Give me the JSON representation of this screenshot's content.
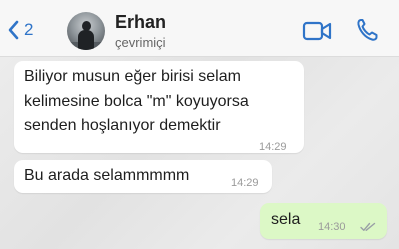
{
  "header": {
    "back_count": "2",
    "contact_name": "Erhan",
    "contact_status": "çevrimiçi"
  },
  "icons": {
    "back": "chevron-left-icon",
    "video": "video-camera-icon",
    "call": "phone-icon"
  },
  "colors": {
    "accent": "#2f74c8",
    "incoming_bubble": "#ffffff",
    "outgoing_bubble": "#dcf8c6",
    "read_ticks": "#9aa0a6"
  },
  "messages": [
    {
      "direction": "incoming",
      "lines": [
        "Biliyor musun eğer birisi selam",
        "kelimesine bolca \"m\" koyuyorsa",
        "senden hoşlanıyor demektir"
      ],
      "time": "14:29"
    },
    {
      "direction": "incoming",
      "lines": [
        "Bu arada selammmmm"
      ],
      "time": "14:29"
    },
    {
      "direction": "outgoing",
      "lines": [
        "sela"
      ],
      "time": "14:30",
      "status": "read"
    }
  ]
}
